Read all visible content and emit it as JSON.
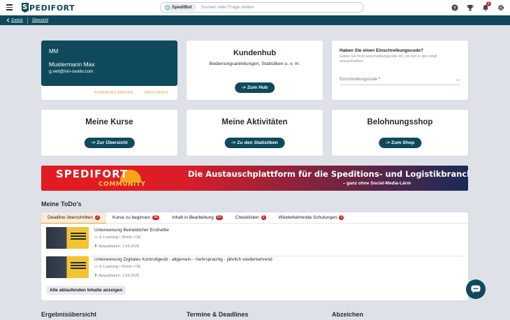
{
  "header": {
    "logo_initial": "S",
    "logo_text": "PEDIFORT",
    "spedibot_label": "SpediBot",
    "search_placeholder": "Suchen oder Frage stellen",
    "notification_count": "1"
  },
  "breadcrumb": {
    "back": "Zurück",
    "overview": "Übersicht"
  },
  "profile": {
    "initials": "MM",
    "name": "Mustermann Max",
    "email": "g.veit@inn-ovativ.com",
    "change_password": "KENNWORT ÄNDERN",
    "my_profile": "MEIN PROFIL"
  },
  "kundenhub": {
    "title": "Kundenhub",
    "subtitle": "Bedienungsanleitungen, Statistiken u. v. m.",
    "button": "-> Zum Hub"
  },
  "enroll": {
    "title": "Haben Sie einen Einschreibungscode?",
    "description": "Geben Sie Ihren Einschreibungscode ein, um sich in den Inhalt einzuschreiben.",
    "input_label": "Einschreibungscode",
    "required_mark": "*"
  },
  "courses": {
    "title": "Meine Kurse",
    "button": "-> Zur Übersicht"
  },
  "activities": {
    "title": "Meine Aktivitäten",
    "button": "-> Zu den Statistiken"
  },
  "shop": {
    "title": "Belohnungsshop",
    "button": "-> Zum Shop"
  },
  "banner": {
    "logo": "SPEDIFORT",
    "logo_sub": "COMMUNITY",
    "headline": "Die Austauschplattform für die Speditions- und Logistikbranche",
    "tagline": "– ganz ohne Social-Media-Lärm"
  },
  "todos": {
    "title": "Meine ToDo's",
    "tabs": [
      {
        "label": "Deadline überschritten",
        "count": "2"
      },
      {
        "label": "Kurse zu beginnen",
        "count": "56"
      },
      {
        "label": "Inhalt in Bearbeitung",
        "count": "63"
      },
      {
        "label": "Checklisten",
        "count": "3"
      },
      {
        "label": "Wiederkehrende Schulungen",
        "count": "2"
      }
    ],
    "items": [
      {
        "title": "Unterweisung Betrieblicher Ersthelfer",
        "meta": "E-Learning • 35min • DE",
        "date": "Ablaufdatum: 1.04.2026"
      },
      {
        "title": "Unterweisung Digitales Kontrollgerät - allgemein - mehrsprachig - jährlich wiederkehrend",
        "meta": "E-Learning • 50min • DE",
        "date": "Ablaufdatum: 1.04.2026"
      }
    ],
    "show_all": "Alle ablaufenden Inhalte anzeigen"
  },
  "bottom_sections": {
    "results": "Ergebnisübersicht",
    "deadlines": "Termine & Deadlines",
    "subscriptions": "Abzeichen"
  },
  "colors": {
    "primary": "#0e4a5c",
    "accent": "#e0a42f",
    "badge": "#c62828"
  }
}
